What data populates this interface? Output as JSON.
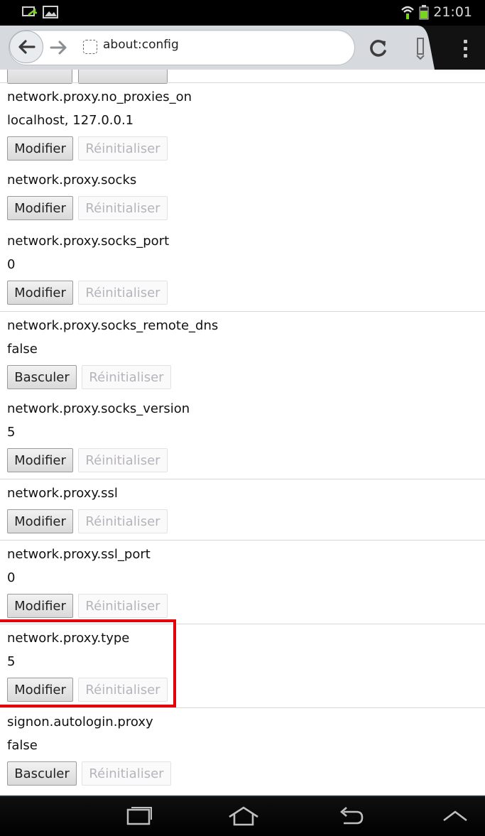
{
  "status_bar": {
    "time": "21:01",
    "icons": [
      "screen-share-icon",
      "image-icon",
      "wifi-icon",
      "battery-icon"
    ]
  },
  "toolbar": {
    "url": "about:config",
    "icons": [
      "back-arrow-icon",
      "forward-arrow-icon",
      "page-icon",
      "reload-icon",
      "tabs-icon",
      "menu-icon"
    ]
  },
  "buttons": {
    "modify": "Modifier",
    "toggle": "Basculer",
    "reset": "Réinitialiser"
  },
  "prefs": [
    {
      "name": "network.proxy.no_proxies_on",
      "value": "localhost, 127.0.0.1",
      "action": "Modifier"
    },
    {
      "name": "network.proxy.socks",
      "value": "",
      "action": "Modifier"
    },
    {
      "name": "network.proxy.socks_port",
      "value": "0",
      "action": "Modifier"
    },
    {
      "name": "network.proxy.socks_remote_dns",
      "value": "false",
      "action": "Basculer"
    },
    {
      "name": "network.proxy.socks_version",
      "value": "5",
      "action": "Modifier"
    },
    {
      "name": "network.proxy.ssl",
      "value": "",
      "action": "Modifier"
    },
    {
      "name": "network.proxy.ssl_port",
      "value": "0",
      "action": "Modifier"
    },
    {
      "name": "network.proxy.type",
      "value": "5",
      "action": "Modifier"
    },
    {
      "name": "signon.autologin.proxy",
      "value": "false",
      "action": "Basculer"
    }
  ],
  "highlight_color": "#e3000b",
  "nav_bar": {
    "icons": [
      "recent-apps-icon",
      "home-icon",
      "back-icon",
      "hide-keyboard-icon"
    ]
  }
}
